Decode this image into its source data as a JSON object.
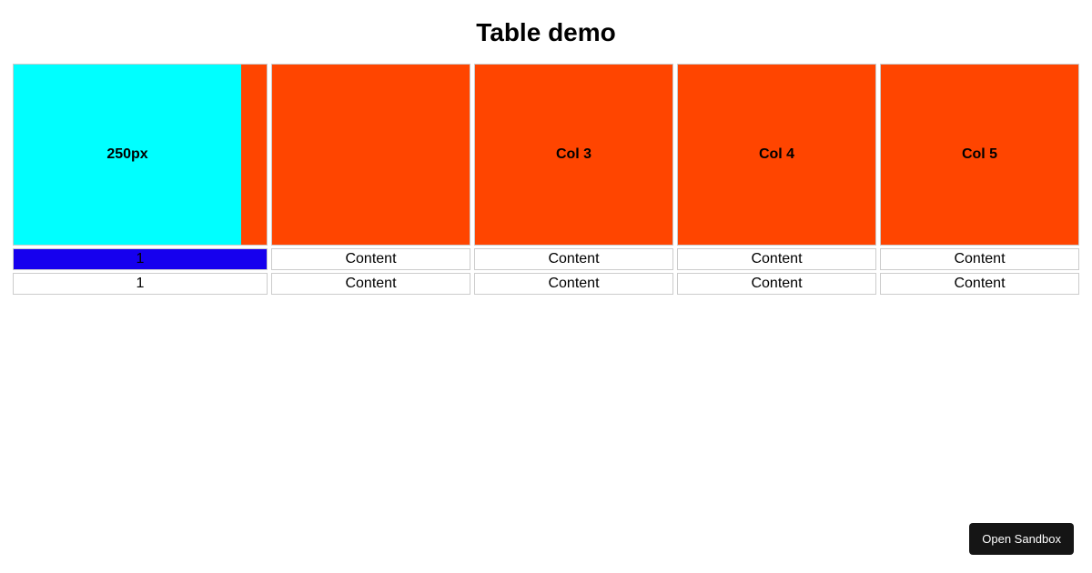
{
  "title": "Table demo",
  "table": {
    "headers": [
      "250px",
      "",
      "Col 3",
      "Col 4",
      "Col 5"
    ],
    "rows": [
      [
        "1",
        "Content",
        "Content",
        "Content",
        "Content"
      ],
      [
        "1",
        "Content",
        "Content",
        "Content",
        "Content"
      ]
    ]
  },
  "button": {
    "open_sandbox": "Open Sandbox"
  },
  "colors": {
    "header_bg": "#ff4500",
    "first_header_box": "#00ffff",
    "first_row_first_cell": "#1600ee"
  }
}
